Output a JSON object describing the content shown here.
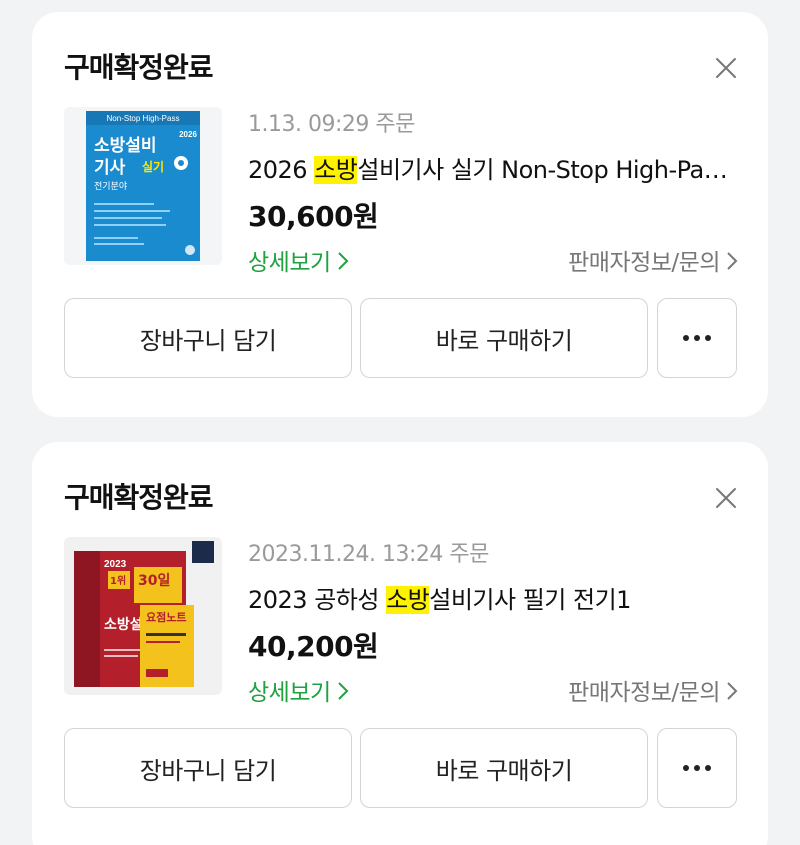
{
  "orders": [
    {
      "status": "구매확정완료",
      "date": "1.13. 09:29 주문",
      "title_pre": "2026 ",
      "title_highlight": "소방",
      "title_post": "설비기사 실기 Non-Stop High-Pass 전기분야",
      "price": "30,600원",
      "detail_link": "상세보기",
      "seller_link": "판매자정보/문의",
      "buttons": {
        "cart": "장바구니 담기",
        "buy": "바로 구매하기"
      },
      "cover": {
        "series": "Non-Stop High-Pass",
        "year": "2026",
        "line1": "소방설비",
        "line2": "기사",
        "badge": "실기",
        "sub": "전기분야"
      },
      "colors": {
        "cover": "#1b8bd0"
      }
    },
    {
      "status": "구매확정완료",
      "date": "2023.11.24. 13:24 주문",
      "title_pre": "2023 공하성 ",
      "title_highlight": "소방",
      "title_post": "설비기사 필기 전기1",
      "price": "40,200원",
      "detail_link": "상세보기",
      "seller_link": "판매자정보/문의",
      "buttons": {
        "cart": "장바구니 담기",
        "buy": "바로 구매하기"
      },
      "cover": {
        "year": "2023",
        "rank": "1위",
        "days": "30일",
        "line1": "소방설",
        "note": "요점노트"
      },
      "colors": {
        "cover": "#b3202c",
        "note": "#f3c21d"
      }
    }
  ],
  "colors": {
    "background": "#f2f3f5",
    "link_green": "#1fa23f",
    "highlight": "#fff200"
  },
  "icons": [
    "close-icon",
    "chevron-right-icon",
    "more-icon"
  ]
}
